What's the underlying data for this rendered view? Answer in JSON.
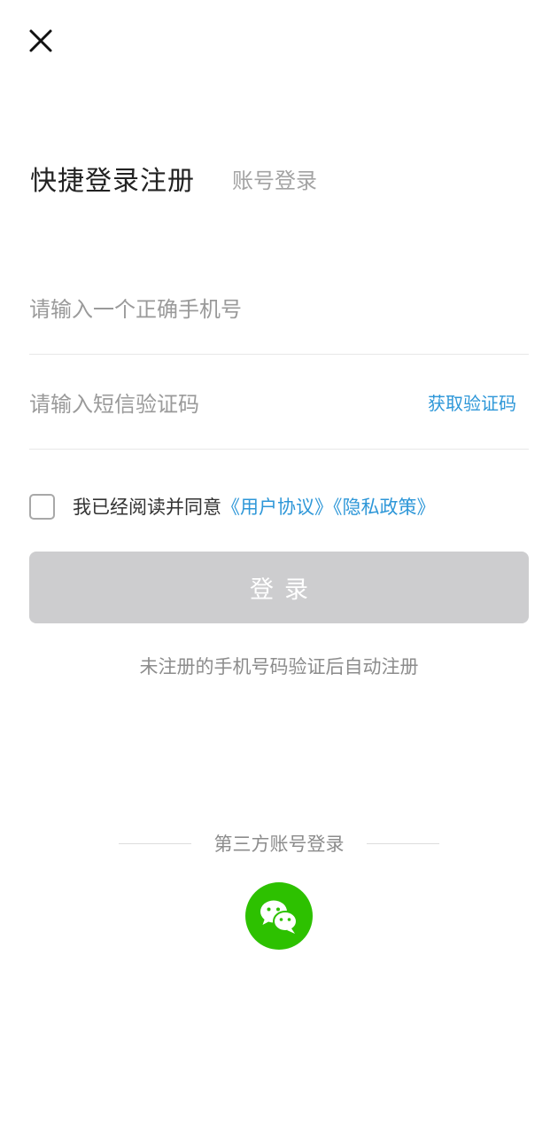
{
  "header": {
    "close_icon": "close-icon"
  },
  "tabs": {
    "quick": "快捷登录注册",
    "account": "账号登录"
  },
  "form": {
    "phone_placeholder": "请输入一个正确手机号",
    "code_placeholder": "请输入短信验证码",
    "get_code_label": "获取验证码"
  },
  "agreement": {
    "prefix": "我已经阅读并同意",
    "user_agreement": "《用户协议》",
    "privacy_policy": "《隐私政策》",
    "checked": false
  },
  "login_button": {
    "label": "登录",
    "enabled": false
  },
  "hint": "未注册的手机号码验证后自动注册",
  "third_party": {
    "title": "第三方账号登录",
    "providers": [
      {
        "name": "wechat",
        "icon": "wechat-icon",
        "color": "#2dc100"
      }
    ]
  },
  "colors": {
    "accent": "#2e97d8",
    "button_disabled": "#cdcdcf",
    "wechat": "#2dc100"
  }
}
